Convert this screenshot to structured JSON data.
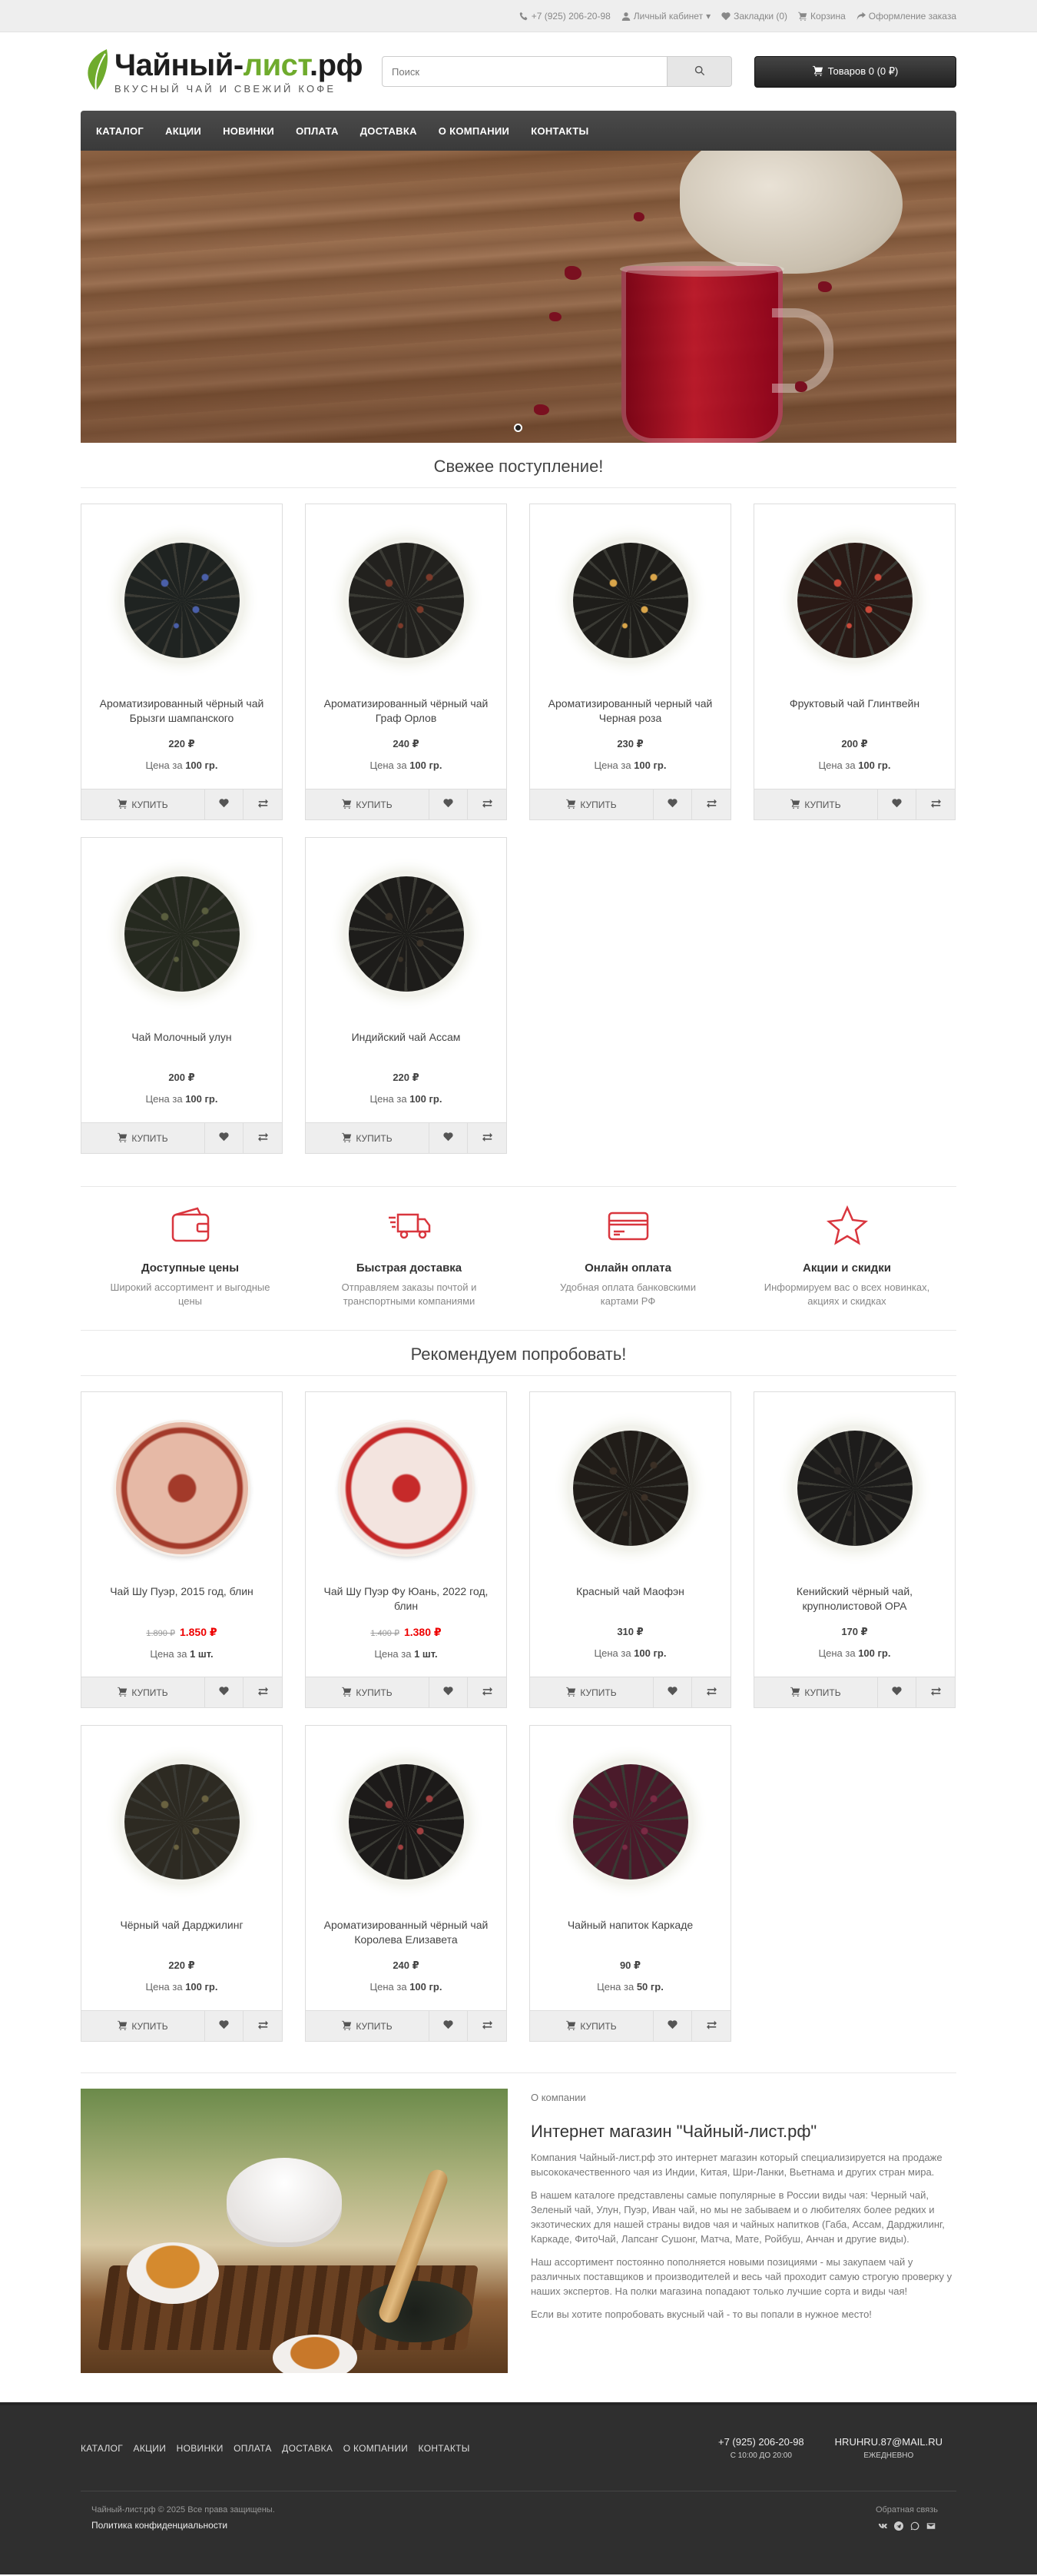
{
  "topbar": {
    "phone": "+7 (925) 206-20-98",
    "account": "Личный кабинет",
    "bookmarks": "Закладки (0)",
    "cart": "Корзина",
    "checkout": "Оформление заказа"
  },
  "header": {
    "logo_part1": "Чайный-",
    "logo_part2": "лист",
    "logo_part3": ".рф",
    "tagline": "ВКУСНЫЙ ЧАЙ И СВЕЖИЙ КОФЕ",
    "search_placeholder": "Поиск",
    "cart_label": "Товаров 0 (0 ₽)"
  },
  "nav": [
    "КАТАЛОГ",
    "АКЦИИ",
    "НОВИНКИ",
    "ОПЛАТА",
    "ДОСТАВКА",
    "О КОМПАНИИ",
    "КОНТАКТЫ"
  ],
  "sections": {
    "fresh": "Свежее поступление!",
    "recommend": "Рекомендуем попробовать!"
  },
  "labels": {
    "buy": "КУПИТЬ",
    "per_prefix": "Цена за"
  },
  "fresh_products": [
    {
      "name": "Ароматизированный чёрный чай Брызги шампанского",
      "price": "220 ₽",
      "unit": "100 гр.",
      "tea": "#1f2321",
      "spot": "#4a5fa8"
    },
    {
      "name": "Ароматизированный чёрный чай Граф Орлов",
      "price": "240 ₽",
      "unit": "100 гр.",
      "tea": "#22211e",
      "spot": "#7c3a2a"
    },
    {
      "name": "Ароматизированный черный чай Черная роза",
      "price": "230 ₽",
      "unit": "100 гр.",
      "tea": "#1e1d1a",
      "spot": "#d9a54a"
    },
    {
      "name": "Фруктовый чай Глинтвейн",
      "price": "200 ₽",
      "unit": "100 гр.",
      "tea": "#2a1a16",
      "spot": "#c94a3a"
    },
    {
      "name": "Чай Молочный улун",
      "price": "200 ₽",
      "unit": "100 гр.",
      "tea": "#25291f",
      "spot": "#5a5e3e"
    },
    {
      "name": "Индийский чай Ассам",
      "price": "220 ₽",
      "unit": "100 гр.",
      "tea": "#1d1c1a",
      "spot": "#3a3228"
    }
  ],
  "features": [
    {
      "icon": "wallet-icon",
      "title": "Доступные цены",
      "desc": "Широкий ассортимент и выгодные цены"
    },
    {
      "icon": "truck-icon",
      "title": "Быстрая доставка",
      "desc": "Отправляем заказы почтой и транспортными компаниями"
    },
    {
      "icon": "credit-card-icon",
      "title": "Онлайн оплата",
      "desc": "Удобная оплата банковскими картами РФ"
    },
    {
      "icon": "star-icon",
      "title": "Акции и скидки",
      "desc": "Информируем вас о всех новинках, акциях и скидках"
    }
  ],
  "recommend_products": [
    {
      "name": "Чай Шу Пуэр, 2015 год, блин",
      "old_price": "1.890 ₽",
      "price": "1.850 ₽",
      "unit": "1 шт.",
      "tea": "#e6b9a6",
      "spot": "#a33a2a",
      "pancake": true
    },
    {
      "name": "Чай Шу Пуэр Фу Юань, 2022 год, блин",
      "old_price": "1.400 ₽",
      "price": "1.380 ₽",
      "unit": "1 шт.",
      "tea": "#f3e4df",
      "spot": "#c62a2a",
      "pancake": true
    },
    {
      "name": "Красный чай Маофэн",
      "price": "310 ₽",
      "unit": "100 гр.",
      "tea": "#201c18",
      "spot": "#3c3026"
    },
    {
      "name": "Кенийский чёрный чай, крупнолистовой OPA",
      "price": "170 ₽",
      "unit": "100 гр.",
      "tea": "#1d1c1b",
      "spot": "#2f2b27"
    },
    {
      "name": "Чёрный чай Дарджилинг",
      "price": "220 ₽",
      "unit": "100 гр.",
      "tea": "#2d2a22",
      "spot": "#6a6240"
    },
    {
      "name": "Ароматизированный чёрный чай Королева Елизавета",
      "price": "240 ₽",
      "unit": "100 гр.",
      "tea": "#1c1a19",
      "spot": "#a04040"
    },
    {
      "name": "Чайный напиток Каркаде",
      "price": "90 ₽",
      "unit": "50 гр.",
      "tea": "#4a1a2a",
      "spot": "#7a2a44"
    }
  ],
  "about": {
    "crumb": "О компании",
    "title": "Интернет магазин \"Чайный-лист.рф\"",
    "p1": "Компания Чайный-лист.рф это интернет магазин который специализируется на продаже высококачественного чая из Индии, Китая, Шри-Ланки, Вьетнама и других стран мира.",
    "p2": "В нашем каталоге представлены самые популярные в России виды чая: Черный чай, Зеленый чай, Улун, Пуэр, Иван чай, но мы не забываем и о любителях более редких и экзотических для нашей страны видов чая и чайных напитков (Габа, Ассам, Дарджилинг, Каркаде, ФитоЧай, Лапсанг Сушонг, Матча, Мате, Ройбуш, Анчан и другие виды).",
    "p3": "Наш ассортимент постоянно пополняется новыми позициями - мы закупаем чай у различных поставщиков и производителей и весь чай проходит самую строгую проверку у наших экспертов. На полки магазина попадают только лучшие сорта и виды чая!",
    "p4": "Если вы хотите попробовать вкусный чай - то вы попали в нужное место!"
  },
  "footer": {
    "links": [
      "КАТАЛОГ",
      "АКЦИИ",
      "НОВИНКИ",
      "ОПЛАТА",
      "ДОСТАВКА",
      "О КОМПАНИИ",
      "КОНТАКТЫ"
    ],
    "phone": "+7 (925) 206-20-98",
    "hours": "С 10:00 ДО 20:00",
    "email": "HRUHRU.87@MAIL.RU",
    "email_note": "ЕЖЕДНЕВНО",
    "copyright": "Чайный-лист.рф © 2025 Все права защищены.",
    "policy": "Политика конфиденциальности",
    "feedback": "Обратная связь"
  },
  "colors": {
    "accent_red": "#d9363e",
    "price_new": "#e00000",
    "logo_green": "#6fab2d"
  }
}
